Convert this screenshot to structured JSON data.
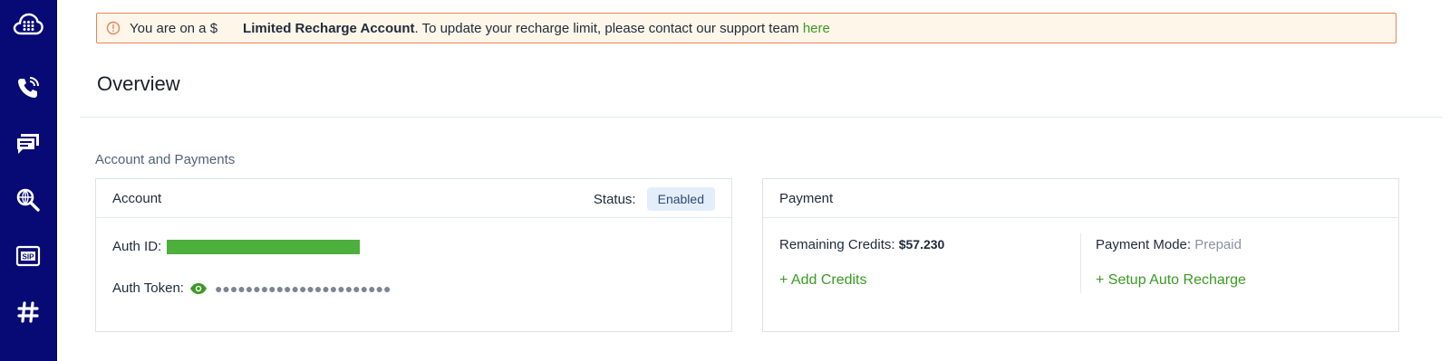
{
  "sidebar": {
    "items": [
      {
        "icon": "cloud-dialpad-icon"
      },
      {
        "icon": "phone-icon"
      },
      {
        "icon": "messages-icon"
      },
      {
        "icon": "global-search-icon"
      },
      {
        "icon": "sip-icon"
      },
      {
        "icon": "hash-icon"
      }
    ],
    "bg_color": "#070a74"
  },
  "banner": {
    "prefix": "You are on a $",
    "account_type": "Limited Recharge Account",
    "message": ". To update your recharge limit, please contact our support team ",
    "link_text": "here",
    "border_color": "#e8835c",
    "bg_color": "#fef6e9"
  },
  "page": {
    "title": "Overview",
    "section_label": "Account and Payments"
  },
  "account_card": {
    "title": "Account",
    "status_label": "Status:",
    "status_value": "Enabled",
    "auth_id_label": "Auth ID:",
    "auth_token_label": "Auth Token:",
    "auth_token_masked": "●●●●●●●●●●●●●●●●●●●●●●●"
  },
  "payment_card": {
    "title": "Payment",
    "remaining_credits_label": "Remaining Credits:",
    "remaining_credits_value": "$57.230",
    "add_credits_label": "+ Add Credits",
    "payment_mode_label": "Payment Mode:",
    "payment_mode_value": "Prepaid",
    "auto_recharge_label": "+ Setup Auto Recharge"
  },
  "colors": {
    "accent_green": "#3a9b22",
    "redaction_green": "#4daf3c"
  }
}
